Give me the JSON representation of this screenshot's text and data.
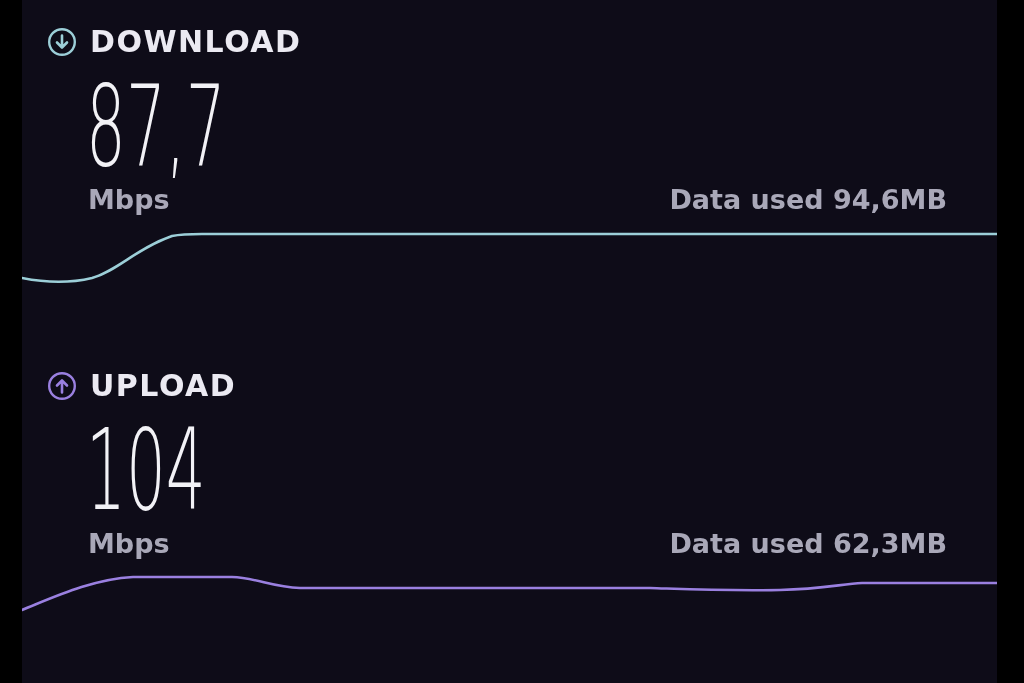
{
  "tests": [
    {
      "kind": "download",
      "color": "#9ccfd8",
      "title": "DOWNLOAD",
      "value": "87,7",
      "unit": "Mbps",
      "data_used": "Data used 94,6MB"
    },
    {
      "kind": "upload",
      "color": "#9a80e0",
      "title": "UPLOAD",
      "value": "104",
      "unit": "Mbps",
      "data_used": "Data used 62,3MB"
    }
  ]
}
